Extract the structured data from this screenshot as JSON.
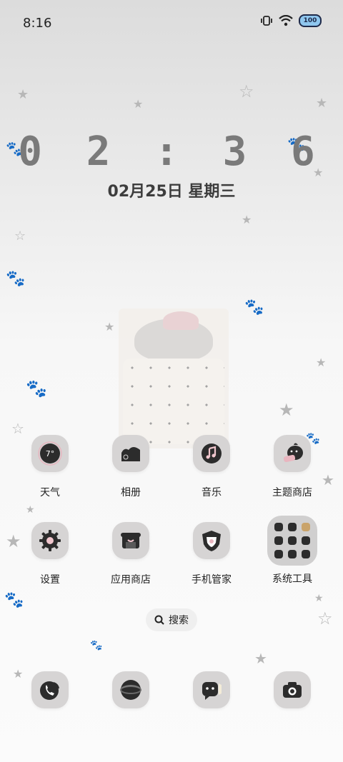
{
  "status_bar": {
    "time": "8:16",
    "battery": "100",
    "icons": [
      "vibrate-icon",
      "wifi-icon",
      "battery-icon"
    ]
  },
  "lock_clock": {
    "time": "0 2 : 3 6",
    "date": "02月25日 星期三"
  },
  "weather_widget": {
    "temperature": "7°"
  },
  "apps_row1": [
    {
      "label": "天气",
      "icon": "weather-icon"
    },
    {
      "label": "相册",
      "icon": "gallery-icon"
    },
    {
      "label": "音乐",
      "icon": "music-icon"
    },
    {
      "label": "主题商店",
      "icon": "theme-store-icon"
    }
  ],
  "apps_row2": [
    {
      "label": "设置",
      "icon": "settings-icon"
    },
    {
      "label": "应用商店",
      "icon": "app-store-icon"
    },
    {
      "label": "手机管家",
      "icon": "phone-manager-icon"
    },
    {
      "label": "系统工具",
      "icon": "system-tools-folder-icon"
    }
  ],
  "search": {
    "label": "搜索",
    "icon": "search-icon"
  },
  "dock": [
    {
      "icon": "phone-icon"
    },
    {
      "icon": "browser-icon"
    },
    {
      "icon": "messages-icon"
    },
    {
      "icon": "camera-icon"
    }
  ],
  "colors": {
    "icon_bg": "#d6d4d4",
    "icon_glyph": "#2c2c2c",
    "accent_pink": "#e9b5bf"
  }
}
